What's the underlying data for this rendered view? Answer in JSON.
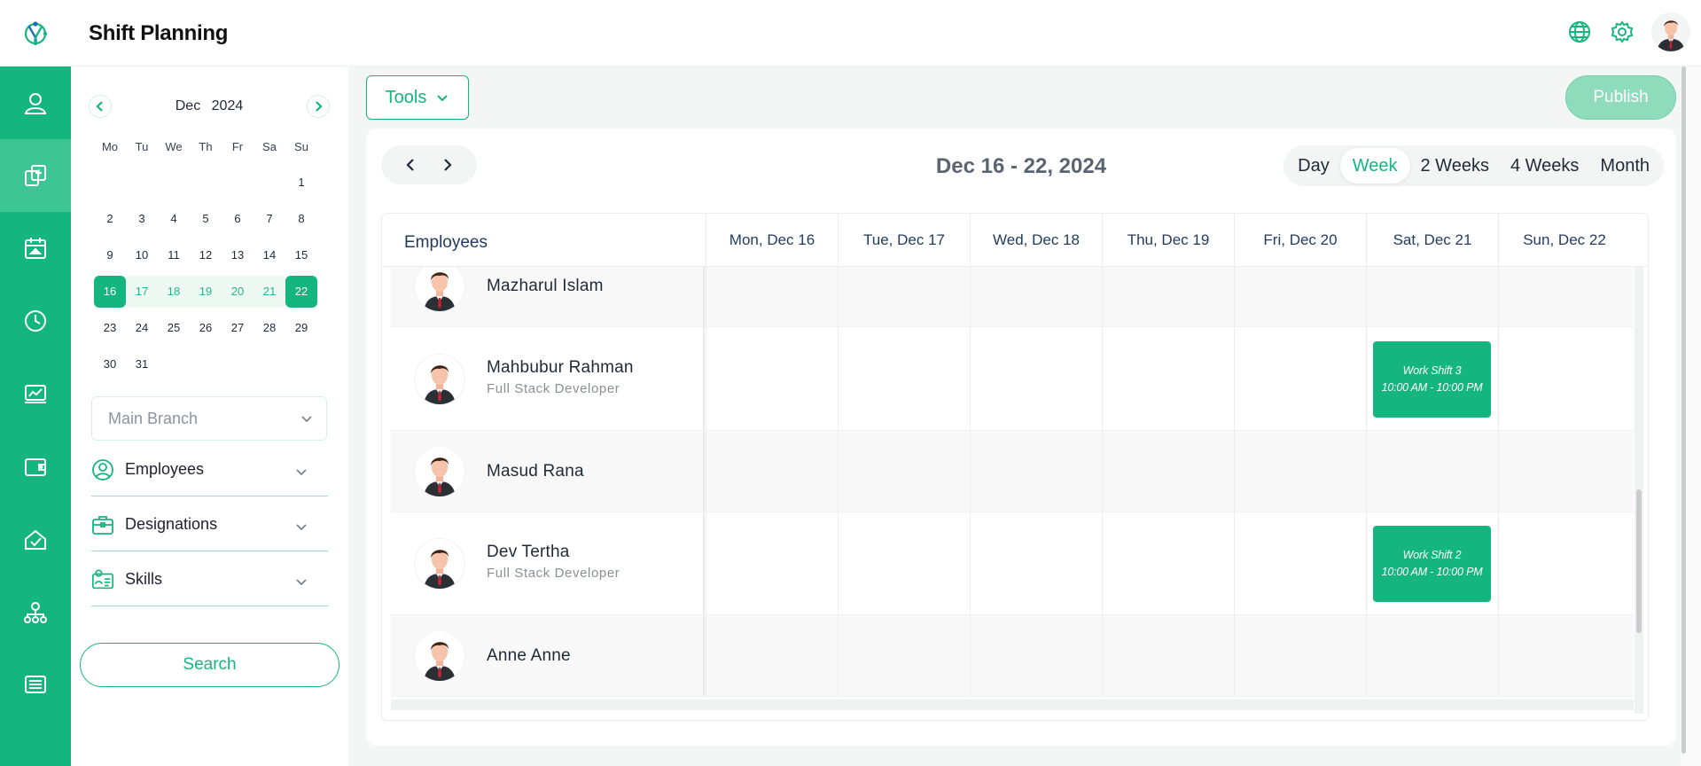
{
  "app": {
    "title": "Shift Planning"
  },
  "header_icons": [
    "globe-icon",
    "settings-icon",
    "user-avatar"
  ],
  "rail": {
    "items": [
      {
        "name": "user-icon",
        "active": false
      },
      {
        "name": "copy-icon",
        "active": true
      },
      {
        "name": "calendar-icon",
        "active": false
      },
      {
        "name": "clock-icon",
        "active": false
      },
      {
        "name": "chart-icon",
        "active": false
      },
      {
        "name": "wallet-icon",
        "active": false
      },
      {
        "name": "checklist-icon",
        "active": false
      },
      {
        "name": "org-chart-icon",
        "active": false
      },
      {
        "name": "list-icon",
        "active": false
      }
    ]
  },
  "mini_calendar": {
    "month": "Dec",
    "year": "2024",
    "weekdays": [
      "Mo",
      "Tu",
      "We",
      "Th",
      "Fr",
      "Sa",
      "Su"
    ],
    "weeks": [
      [
        "",
        "",
        "",
        "",
        "",
        "",
        "1"
      ],
      [
        "2",
        "3",
        "4",
        "5",
        "6",
        "7",
        "8"
      ],
      [
        "9",
        "10",
        "11",
        "12",
        "13",
        "14",
        "15"
      ],
      [
        "16",
        "17",
        "18",
        "19",
        "20",
        "21",
        "22"
      ],
      [
        "23",
        "24",
        "25",
        "26",
        "27",
        "28",
        "29"
      ],
      [
        "30",
        "31",
        "",
        "",
        "",
        "",
        ""
      ]
    ],
    "range_start": "16",
    "range_end": "22"
  },
  "filters": {
    "branch": "Main Branch",
    "employees_label": "Employees",
    "designations_label": "Designations",
    "skills_label": "Skills",
    "search_label": "Search"
  },
  "toolbar": {
    "tools_label": "Tools",
    "publish_label": "Publish"
  },
  "schedule": {
    "range_title": "Dec 16 - 22, 2024",
    "views": [
      "Day",
      "Week",
      "2 Weeks",
      "4 Weeks",
      "Month"
    ],
    "active_view": "Week",
    "employees_header": "Employees",
    "days": [
      "Mon, Dec 16",
      "Tue, Dec 17",
      "Wed, Dec 18",
      "Thu, Dec 19",
      "Fri, Dec 20",
      "Sat, Dec 21",
      "Sun, Dec 22"
    ],
    "rows": [
      {
        "name": "Mazharul Islam",
        "role": "",
        "shifts": []
      },
      {
        "name": "Mahbubur Rahman",
        "role": "Full Stack Developer",
        "shifts": [
          {
            "day": 5,
            "title": "Work Shift 3",
            "time": "10:00 AM - 10:00 PM"
          }
        ]
      },
      {
        "name": "Masud Rana",
        "role": "",
        "shifts": []
      },
      {
        "name": "Dev Tertha",
        "role": "Full Stack Developer",
        "shifts": [
          {
            "day": 5,
            "title": "Work Shift 2",
            "time": "10:00 AM - 10:00 PM"
          }
        ]
      },
      {
        "name": "Anne Anne",
        "role": "",
        "shifts": []
      }
    ]
  },
  "colors": {
    "brand": "#15b57f",
    "publish_disabled": "#8fdcbd"
  }
}
